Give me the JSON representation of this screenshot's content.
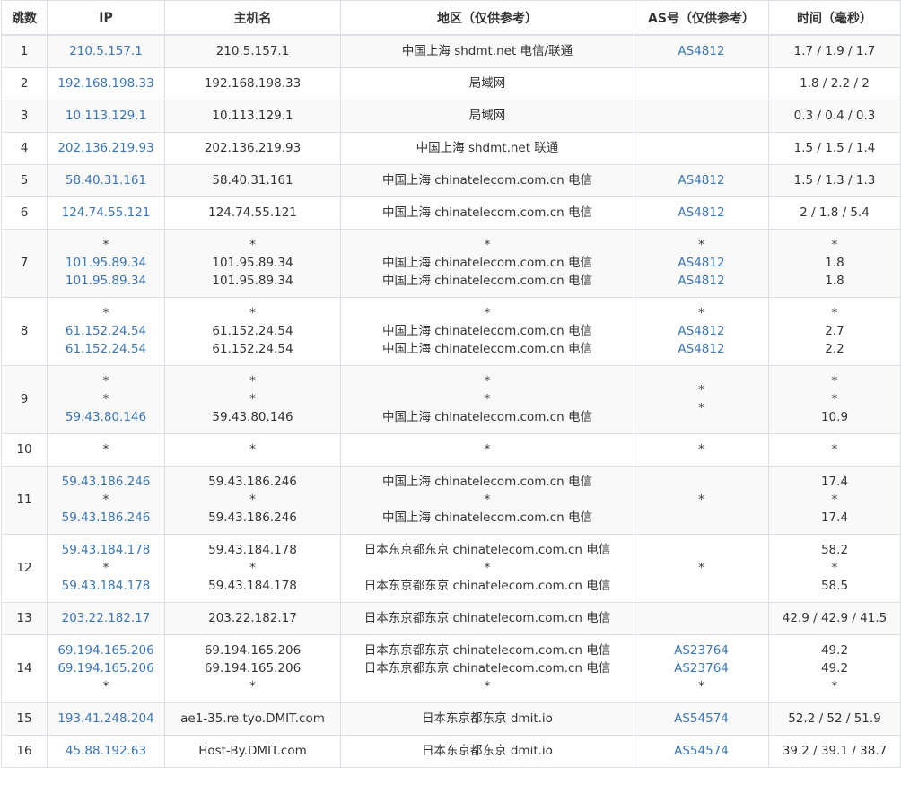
{
  "headers": {
    "hop": "跳数",
    "ip": "IP",
    "host": "主机名",
    "region": "地区（仅供参考）",
    "as": "AS号（仅供参考）",
    "time": "时间（毫秒）"
  },
  "rows": [
    {
      "hop": "1",
      "ip": [
        "210.5.157.1"
      ],
      "host": [
        "210.5.157.1"
      ],
      "region": [
        "中国上海 shdmt.net 电信/联通"
      ],
      "as": [
        "AS4812"
      ],
      "time": [
        "1.7 / 1.9 / 1.7"
      ]
    },
    {
      "hop": "2",
      "ip": [
        "192.168.198.33"
      ],
      "host": [
        "192.168.198.33"
      ],
      "region": [
        "局域网"
      ],
      "as": [
        ""
      ],
      "time": [
        "1.8 / 2.2 / 2"
      ]
    },
    {
      "hop": "3",
      "ip": [
        "10.113.129.1"
      ],
      "host": [
        "10.113.129.1"
      ],
      "region": [
        "局域网"
      ],
      "as": [
        ""
      ],
      "time": [
        "0.3 / 0.4 / 0.3"
      ]
    },
    {
      "hop": "4",
      "ip": [
        "202.136.219.93"
      ],
      "host": [
        "202.136.219.93"
      ],
      "region": [
        "中国上海 shdmt.net 联通"
      ],
      "as": [
        ""
      ],
      "time": [
        "1.5 / 1.5 / 1.4"
      ]
    },
    {
      "hop": "5",
      "ip": [
        "58.40.31.161"
      ],
      "host": [
        "58.40.31.161"
      ],
      "region": [
        "中国上海 chinatelecom.com.cn 电信"
      ],
      "as": [
        "AS4812"
      ],
      "time": [
        "1.5 / 1.3 / 1.3"
      ]
    },
    {
      "hop": "6",
      "ip": [
        "124.74.55.121"
      ],
      "host": [
        "124.74.55.121"
      ],
      "region": [
        "中国上海 chinatelecom.com.cn 电信"
      ],
      "as": [
        "AS4812"
      ],
      "time": [
        "2 / 1.8 / 5.4"
      ]
    },
    {
      "hop": "7",
      "ip": [
        "*",
        "101.95.89.34",
        "101.95.89.34"
      ],
      "host": [
        "*",
        "101.95.89.34",
        "101.95.89.34"
      ],
      "region": [
        "*",
        "中国上海 chinatelecom.com.cn 电信",
        "中国上海 chinatelecom.com.cn 电信"
      ],
      "as": [
        "*",
        "AS4812",
        "AS4812"
      ],
      "time": [
        "*",
        "1.8",
        "1.8"
      ]
    },
    {
      "hop": "8",
      "ip": [
        "*",
        "61.152.24.54",
        "61.152.24.54"
      ],
      "host": [
        "*",
        "61.152.24.54",
        "61.152.24.54"
      ],
      "region": [
        "*",
        "中国上海 chinatelecom.com.cn 电信",
        "中国上海 chinatelecom.com.cn 电信"
      ],
      "as": [
        "*",
        "AS4812",
        "AS4812"
      ],
      "time": [
        "*",
        "2.7",
        "2.2"
      ]
    },
    {
      "hop": "9",
      "ip": [
        "*",
        "*",
        "59.43.80.146"
      ],
      "host": [
        "*",
        "*",
        "59.43.80.146"
      ],
      "region": [
        "*",
        "*",
        "中国上海 chinatelecom.com.cn 电信"
      ],
      "as": [
        "*",
        "*"
      ],
      "time": [
        "*",
        "*",
        "10.9"
      ]
    },
    {
      "hop": "10",
      "ip": [
        "*"
      ],
      "host": [
        "*"
      ],
      "region": [
        "*"
      ],
      "as": [
        "*"
      ],
      "time": [
        "*"
      ]
    },
    {
      "hop": "11",
      "ip": [
        "59.43.186.246",
        "*",
        "59.43.186.246"
      ],
      "host": [
        "59.43.186.246",
        "*",
        "59.43.186.246"
      ],
      "region": [
        "中国上海 chinatelecom.com.cn 电信",
        "*",
        "中国上海 chinatelecom.com.cn 电信"
      ],
      "as": [
        "*"
      ],
      "time": [
        "17.4",
        "*",
        "17.4"
      ]
    },
    {
      "hop": "12",
      "ip": [
        "59.43.184.178",
        "*",
        "59.43.184.178"
      ],
      "host": [
        "59.43.184.178",
        "*",
        "59.43.184.178"
      ],
      "region": [
        "日本东京都东京 chinatelecom.com.cn 电信",
        "*",
        "日本东京都东京 chinatelecom.com.cn 电信"
      ],
      "as": [
        "*"
      ],
      "time": [
        "58.2",
        "*",
        "58.5"
      ]
    },
    {
      "hop": "13",
      "ip": [
        "203.22.182.17"
      ],
      "host": [
        "203.22.182.17"
      ],
      "region": [
        "日本东京都东京 chinatelecom.com.cn 电信"
      ],
      "as": [
        ""
      ],
      "time": [
        "42.9 / 42.9 / 41.5"
      ]
    },
    {
      "hop": "14",
      "ip": [
        "69.194.165.206",
        "69.194.165.206",
        "*"
      ],
      "host": [
        "69.194.165.206",
        "69.194.165.206",
        "*"
      ],
      "region": [
        "日本东京都东京 chinatelecom.com.cn 电信",
        "日本东京都东京 chinatelecom.com.cn 电信",
        "*"
      ],
      "as": [
        "AS23764",
        "AS23764",
        "*"
      ],
      "time": [
        "49.2",
        "49.2",
        "*"
      ]
    },
    {
      "hop": "15",
      "ip": [
        "193.41.248.204"
      ],
      "host": [
        "ae1-35.re.tyo.DMIT.com"
      ],
      "region": [
        "日本东京都东京 dmit.io"
      ],
      "as": [
        "AS54574"
      ],
      "time": [
        "52.2 / 52 / 51.9"
      ]
    },
    {
      "hop": "16",
      "ip": [
        "45.88.192.63"
      ],
      "host": [
        "Host-By.DMIT.com"
      ],
      "region": [
        "日本东京都东京 dmit.io"
      ],
      "as": [
        "AS54574"
      ],
      "time": [
        "39.2 / 39.1 / 38.7"
      ]
    }
  ]
}
